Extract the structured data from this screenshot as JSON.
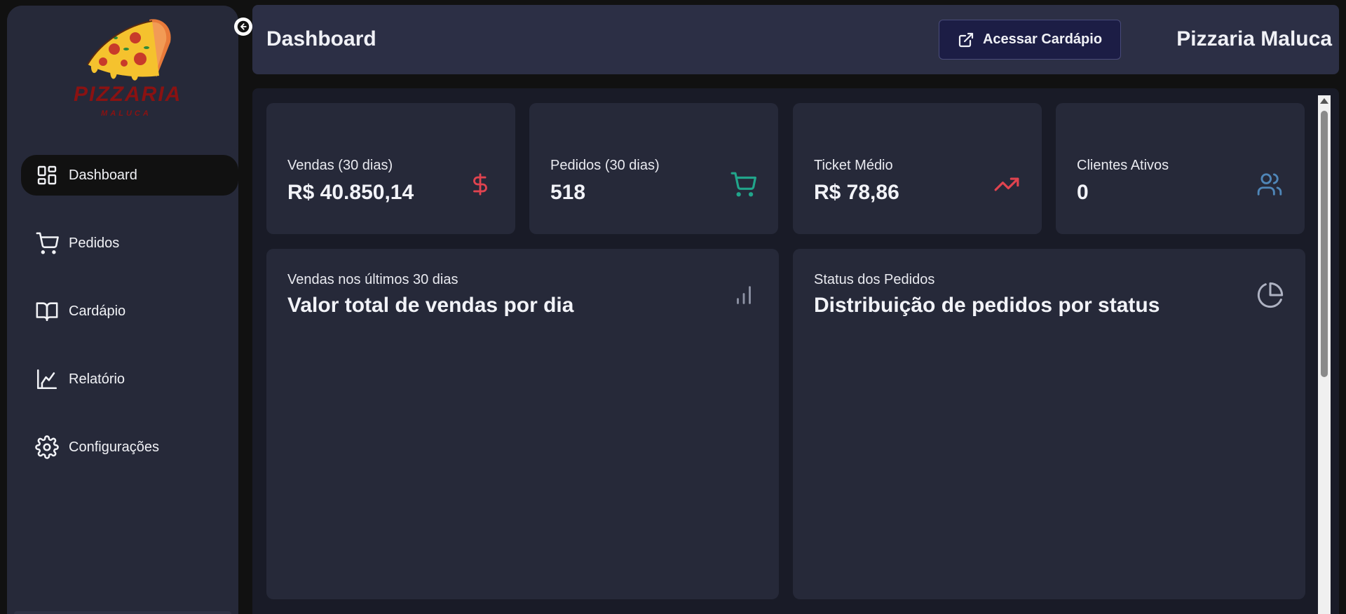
{
  "sidebar": {
    "logo": {
      "line1": "PIZZARIA",
      "line2": "MALUCA"
    },
    "items": [
      {
        "label": "Dashboard",
        "icon": "layout-dashboard-icon"
      },
      {
        "label": "Pedidos",
        "icon": "cart-icon"
      },
      {
        "label": "Cardápio",
        "icon": "book-open-icon"
      },
      {
        "label": "Relatório",
        "icon": "chart-icon"
      },
      {
        "label": "Configurações",
        "icon": "gear-icon"
      }
    ]
  },
  "header": {
    "title": "Dashboard",
    "menu_button": "Acessar Cardápio",
    "brand": "Pizzaria Maluca"
  },
  "stats": [
    {
      "label": "Vendas (30 dias)",
      "value": "R$ 40.850,14",
      "icon": "dollar-icon",
      "color": "#e0434f"
    },
    {
      "label": "Pedidos (30 dias)",
      "value": "518",
      "icon": "cart-icon",
      "color": "#21a58b"
    },
    {
      "label": "Ticket Médio",
      "value": "R$ 78,86",
      "icon": "trending-up-icon",
      "color": "#e0434f"
    },
    {
      "label": "Clientes Ativos",
      "value": "0",
      "icon": "users-icon",
      "color": "#4f86b8"
    }
  ],
  "charts": [
    {
      "subtitle": "Vendas nos últimos 30 dias",
      "title": "Valor total de vendas por dia",
      "icon": "bar-chart-icon"
    },
    {
      "subtitle": "Status dos Pedidos",
      "title": "Distribuição de pedidos por status",
      "icon": "pie-chart-icon"
    }
  ],
  "colors": {
    "background": "#111111",
    "sidebar": "#262939",
    "header": "#2c2f45",
    "main": "#191b27",
    "card": "#262939",
    "accent_button": "#1c1d45"
  }
}
